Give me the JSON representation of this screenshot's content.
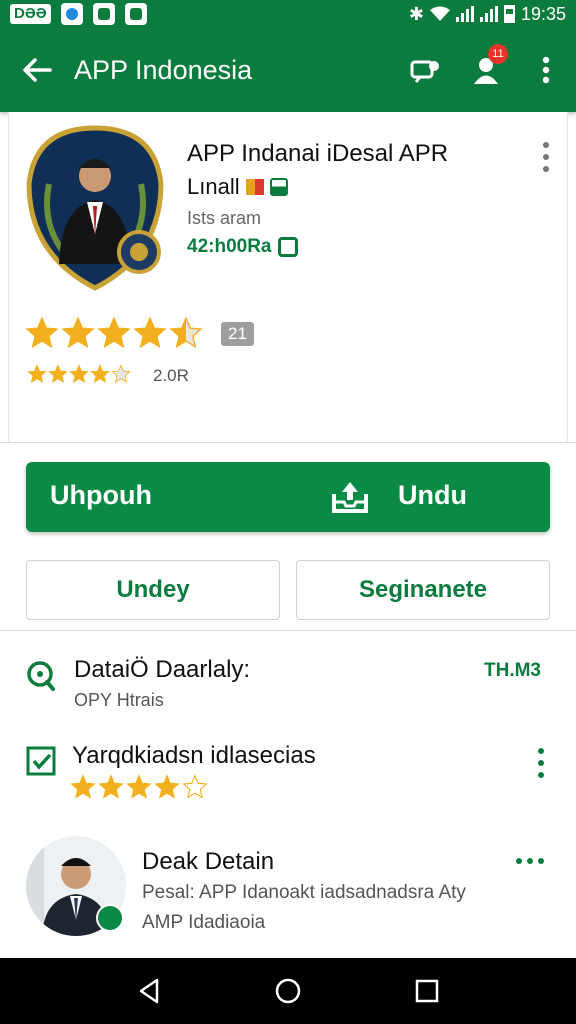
{
  "status_bar": {
    "carrier": "DƏƏ",
    "time": "19:35"
  },
  "app_bar": {
    "title": "APP Indonesia",
    "notification_count": "11"
  },
  "app_header": {
    "name": "APP Indanai iDesal APR",
    "subtitle": "Lınall",
    "meta": "Ists aram",
    "size": "42:h00Ra",
    "rating_value": "21",
    "rating_count": "2.0R",
    "big_stars": 4.5,
    "small_stars": 4
  },
  "buttons": {
    "install_left": "Uhpouh",
    "install_right": "Undu",
    "secondary_left": "Undey",
    "secondary_right": "Seginanete"
  },
  "details": {
    "row1_title": "DataiÖ Daarlaly:",
    "row1_sub": "OPY Htrais",
    "row1_right": "TH.M3",
    "row2_title": "Yarqdkiadsn idlasecias",
    "row2_stars": 4,
    "row3_title": "Deak Detain",
    "row3_line1": "Pesal: APP Idanoakt iadsadnadsra Aty",
    "row3_line2": "AMP Idadiaoia"
  },
  "colors": {
    "brand_green": "#0b7c3e",
    "star_gold": "#f2b01e"
  },
  "icons": [
    "back-arrow-icon",
    "share-icon",
    "account-icon",
    "more-vert-icon",
    "search-icon",
    "checkbox-icon",
    "nav-back-icon",
    "nav-home-icon",
    "nav-recents-icon"
  ]
}
